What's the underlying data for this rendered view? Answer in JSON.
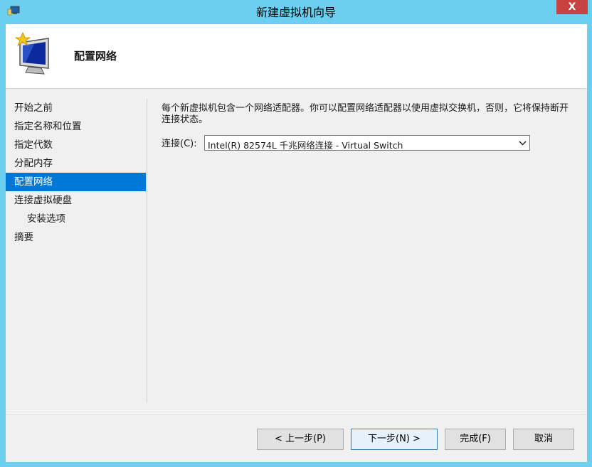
{
  "window": {
    "title": "新建虚拟机向导",
    "close_label": "X"
  },
  "header": {
    "title": "配置网络"
  },
  "sidebar": {
    "items": [
      {
        "label": "开始之前"
      },
      {
        "label": "指定名称和位置"
      },
      {
        "label": "指定代数"
      },
      {
        "label": "分配内存"
      },
      {
        "label": "配置网络",
        "active": true
      },
      {
        "label": "连接虚拟硬盘"
      },
      {
        "label": "安装选项",
        "sub": true
      },
      {
        "label": "摘要"
      }
    ]
  },
  "main": {
    "description": "每个新虚拟机包含一个网络适配器。你可以配置网络适配器以使用虚拟交换机，否则，它将保持断开连接状态。",
    "connection_label": "连接(C):",
    "connection_value": "Intel(R) 82574L 千兆网络连接 - Virtual Switch"
  },
  "footer": {
    "prev_label": "< 上一步(P)",
    "next_label": "下一步(N) >",
    "finish_label": "完成(F)",
    "cancel_label": "取消"
  },
  "colors": {
    "frame": "#6ccff0",
    "selected": "#0078d7",
    "close": "#c74343"
  }
}
